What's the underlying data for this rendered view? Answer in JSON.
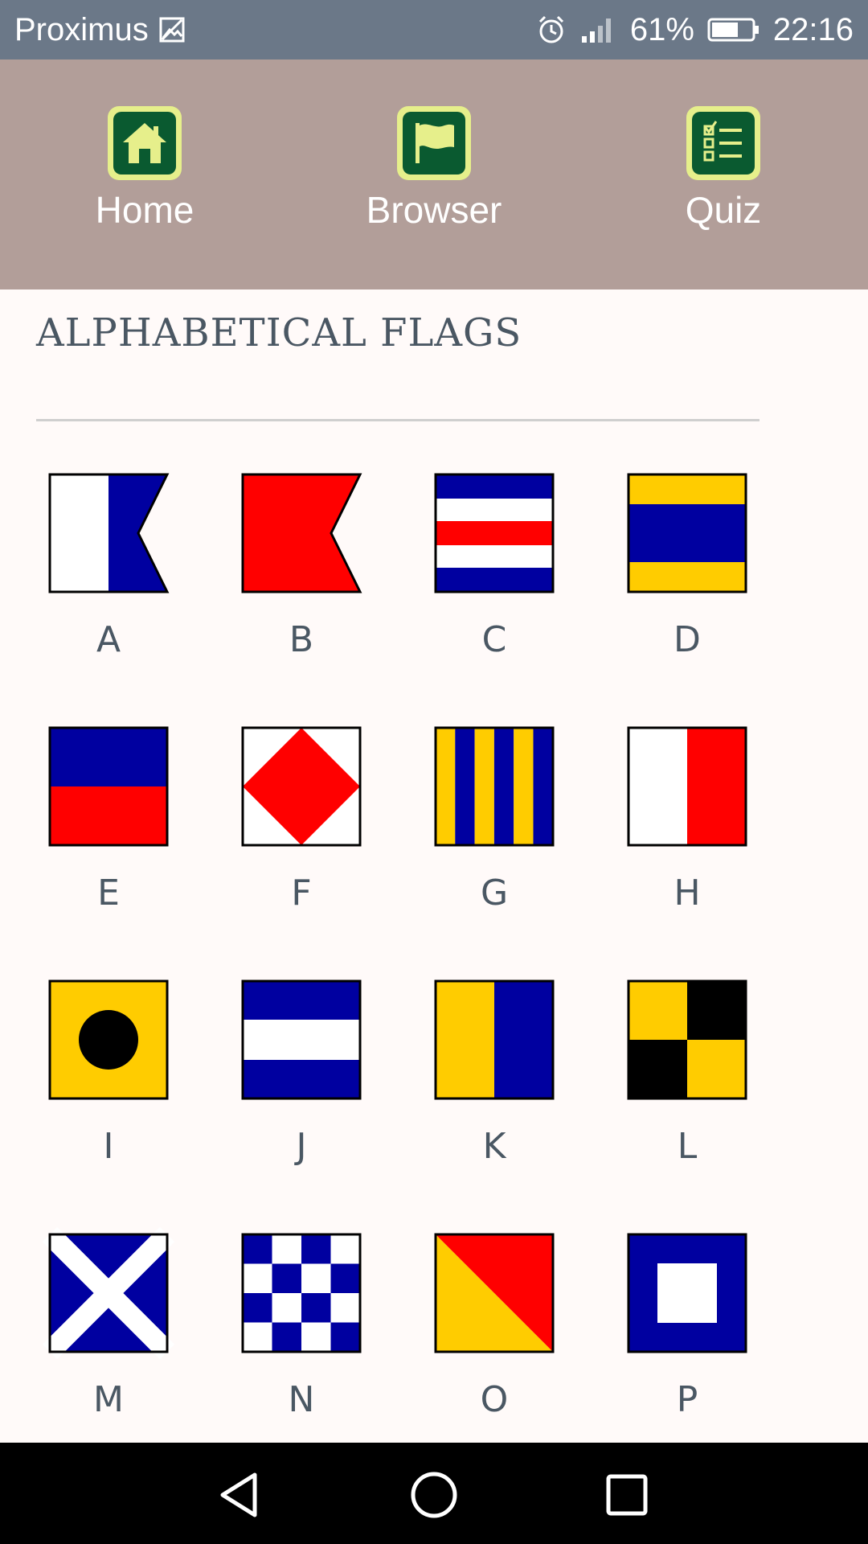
{
  "status_bar": {
    "carrier": "Proximus",
    "battery": "61%",
    "time": "22:16"
  },
  "nav": {
    "items": [
      {
        "label": "Home",
        "icon": "home-icon"
      },
      {
        "label": "Browser",
        "icon": "flag-icon"
      },
      {
        "label": "Quiz",
        "icon": "checklist-icon"
      }
    ]
  },
  "page": {
    "title": "ALPHABETICAL FLAGS"
  },
  "flags": [
    {
      "letter": "A"
    },
    {
      "letter": "B"
    },
    {
      "letter": "C"
    },
    {
      "letter": "D"
    },
    {
      "letter": "E"
    },
    {
      "letter": "F"
    },
    {
      "letter": "G"
    },
    {
      "letter": "H"
    },
    {
      "letter": "I"
    },
    {
      "letter": "J"
    },
    {
      "letter": "K"
    },
    {
      "letter": "L"
    },
    {
      "letter": "M"
    },
    {
      "letter": "N"
    },
    {
      "letter": "O"
    },
    {
      "letter": "P"
    }
  ],
  "colors": {
    "blue": "#0000a0",
    "red": "#ff0000",
    "yellow": "#ffcc00",
    "white": "#ffffff",
    "black": "#000000",
    "header_bg": "#b29e99",
    "status_bg": "#6b7888"
  },
  "system_nav": {
    "icons": [
      "back-icon",
      "home-circle-icon",
      "recents-icon"
    ]
  }
}
